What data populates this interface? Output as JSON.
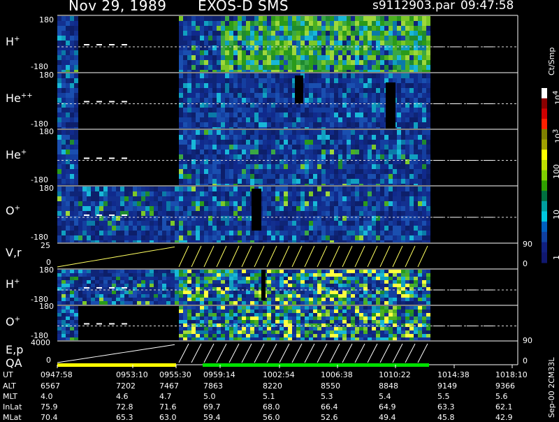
{
  "header": {
    "date": "Nov 29, 1989",
    "mission": "EXOS-D SMS",
    "file": "s9112903.par",
    "time": "09:47:58"
  },
  "panels": [
    {
      "id": "h-plus",
      "label": "H",
      "sup": "+",
      "ymax": "180",
      "ymin": "-180"
    },
    {
      "id": "he-plus-plus",
      "label": "He",
      "sup": "++",
      "ymax": "180",
      "ymin": "-180"
    },
    {
      "id": "he-plus",
      "label": "He",
      "sup": "+",
      "ymax": "180",
      "ymin": "-180"
    },
    {
      "id": "o-plus",
      "label": "O",
      "sup": "+",
      "ymax": "180",
      "ymin": "-180"
    },
    {
      "id": "v-r",
      "label": "V,r",
      "sup": "",
      "ymax": "25",
      "ymin": "0",
      "rmax": "90",
      "rmin": "0"
    },
    {
      "id": "h-plus-2",
      "label": "H",
      "sup": "+",
      "ymax": "180",
      "ymin": "-180"
    },
    {
      "id": "o-plus-2",
      "label": "O",
      "sup": "+",
      "ymax": "180",
      "ymin": "-180"
    },
    {
      "id": "e-p",
      "label": "E,p",
      "sup": "",
      "ymax": "4000",
      "ymin": "0",
      "rmax": "90",
      "rmin": "0"
    }
  ],
  "qa_label": "QA",
  "colorbar": {
    "unit": "Ct/Smp",
    "labels": [
      "10",
      "10",
      "100",
      "10",
      "1"
    ],
    "label_sups": [
      "4",
      "3",
      "",
      "",
      ""
    ],
    "colors": [
      "#ffffff",
      "#8b0000",
      "#d00000",
      "#ff2000",
      "#808000",
      "#a0a000",
      "#ffff00",
      "#c0e000",
      "#80d000",
      "#30a000",
      "#007040",
      "#00a0a0",
      "#00c8e0",
      "#0060c0",
      "#1040a0",
      "#102080",
      "#101870"
    ]
  },
  "side_text": "Sep-00  2CM33L",
  "ephemeris": {
    "labels": [
      "UT",
      "ALT",
      "MLT",
      "InLat",
      "MLat"
    ],
    "columns": [
      [
        "0947:58",
        "6567",
        "4.0",
        "75.9",
        "70.4"
      ],
      [
        "0953:10",
        "7202",
        "4.6",
        "72.8",
        "65.3"
      ],
      [
        "0955:30",
        "7467",
        "4.7",
        "71.6",
        "63.0"
      ],
      [
        "0959:14",
        "7863",
        "5.0",
        "69.7",
        "59.4"
      ],
      [
        "1002:54",
        "8220",
        "5.1",
        "68.0",
        "56.0"
      ],
      [
        "1006:38",
        "8550",
        "5.3",
        "66.4",
        "52.6"
      ],
      [
        "1010:22",
        "8848",
        "5.4",
        "64.9",
        "49.4"
      ],
      [
        "1014:38",
        "9149",
        "5.5",
        "63.3",
        "45.8"
      ],
      [
        "1018:10",
        "9366",
        "5.6",
        "62.1",
        "42.9"
      ]
    ]
  },
  "chart_data": {
    "type": "heatmap",
    "title": "Nov 29, 1989   EXOS-D SMS",
    "x_ticks": [
      "0947:58",
      "0953:10",
      "0955:30",
      "0959:14",
      "1002:54",
      "1006:38",
      "1010:22",
      "1014:38",
      "1018:10"
    ],
    "colorbar_scale": "log",
    "colorbar_range": [
      1,
      10000
    ],
    "colorbar_ticks": [
      1,
      10,
      100,
      1000,
      10000
    ],
    "qa_segments": [
      {
        "from": "0947:58",
        "to": "0955:30",
        "color": "#ffff00"
      },
      {
        "from": "0959:14",
        "to": "1010:22",
        "color": "#00e000"
      }
    ]
  }
}
